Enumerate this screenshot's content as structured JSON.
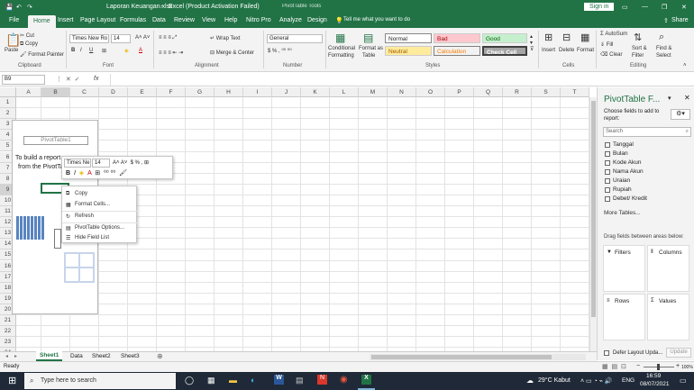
{
  "title": {
    "file": "Laporan Keuangan.xlsx",
    "sep": " - ",
    "app": "Excel (Product Activation Failed)",
    "context": "PivotTable Tools",
    "signin": "Sign in"
  },
  "tabs": [
    "File",
    "Home",
    "Insert",
    "Page Layout",
    "Formulas",
    "Data",
    "Review",
    "View",
    "Help",
    "Nitro Pro",
    "Analyze",
    "Design"
  ],
  "tell_me": "Tell me what you want to do",
  "share": "Share",
  "clipboard": {
    "paste": "Paste",
    "cut": "Cut",
    "copy": "Copy",
    "painter": "Format Painter",
    "label": "Clipboard"
  },
  "font": {
    "name": "Times New Ro",
    "size": "14",
    "label": "Font"
  },
  "alignment": {
    "wrap": "Wrap Text",
    "merge": "Merge & Center",
    "label": "Alignment"
  },
  "number": {
    "format": "General",
    "label": "Number"
  },
  "styles": {
    "cond": "Conditional",
    "cond2": "Formatting",
    "fmt_table": "Format as",
    "fmt_table2": "Table",
    "normal": "Normal",
    "bad": "Bad",
    "good": "Good",
    "neutral": "Neutral",
    "calculation": "Calculation",
    "check": "Check Cell",
    "label": "Styles"
  },
  "cells": {
    "insert": "Insert",
    "delete": "Delete",
    "format": "Format",
    "label": "Cells"
  },
  "editing": {
    "autosum": "AutoSum",
    "fill": "Fill",
    "clear": "Clear",
    "sort": "Sort &",
    "sort2": "Filter",
    "find": "Find &",
    "find2": "Select",
    "label": "Editing"
  },
  "namebox": "B9",
  "fx": "fx",
  "columns": [
    "A",
    "B",
    "C",
    "D",
    "E",
    "F",
    "G",
    "H",
    "I",
    "J",
    "K",
    "L",
    "M",
    "N",
    "O",
    "P",
    "Q",
    "R",
    "S",
    "T"
  ],
  "rows": [
    "1",
    "2",
    "3",
    "4",
    "5",
    "6",
    "7",
    "8",
    "9",
    "10",
    "11",
    "12",
    "13",
    "14",
    "15",
    "16",
    "17",
    "18",
    "19",
    "20",
    "21",
    "22",
    "23",
    "24"
  ],
  "pivot": {
    "name": "PivotTable1",
    "line1": "To build a report, c",
    "line2": "from the PivotTa"
  },
  "mini": {
    "font": "Times Ne",
    "size": "14"
  },
  "context_menu": [
    "Copy",
    "Format Cells...",
    "Refresh",
    "PivotTable Options...",
    "Hide Field List"
  ],
  "pane": {
    "title": "PivotTable F...",
    "choose": "Choose fields to add to report:",
    "search": "Search",
    "fields": [
      "Tanggal",
      "Bulan",
      "Kode Akun",
      "Nama Akun",
      "Uraian",
      "Rupiah",
      "Debet/ Kredit"
    ],
    "more": "More Tables...",
    "drag": "Drag fields between areas below:",
    "filters": "Filters",
    "columns": "Columns",
    "rows": "Rows",
    "values": "Values",
    "defer": "Defer Layout Upda...",
    "update": "Update"
  },
  "sheets": [
    "Sheet1",
    "Data",
    "Sheet2",
    "Sheet3"
  ],
  "status": {
    "ready": "Ready",
    "zoom": "100%"
  },
  "taskbar": {
    "search": "Type here to search",
    "weather": "29°C Kabut",
    "lang": "ENG",
    "time": "16:59",
    "date": "08/07/2021"
  }
}
